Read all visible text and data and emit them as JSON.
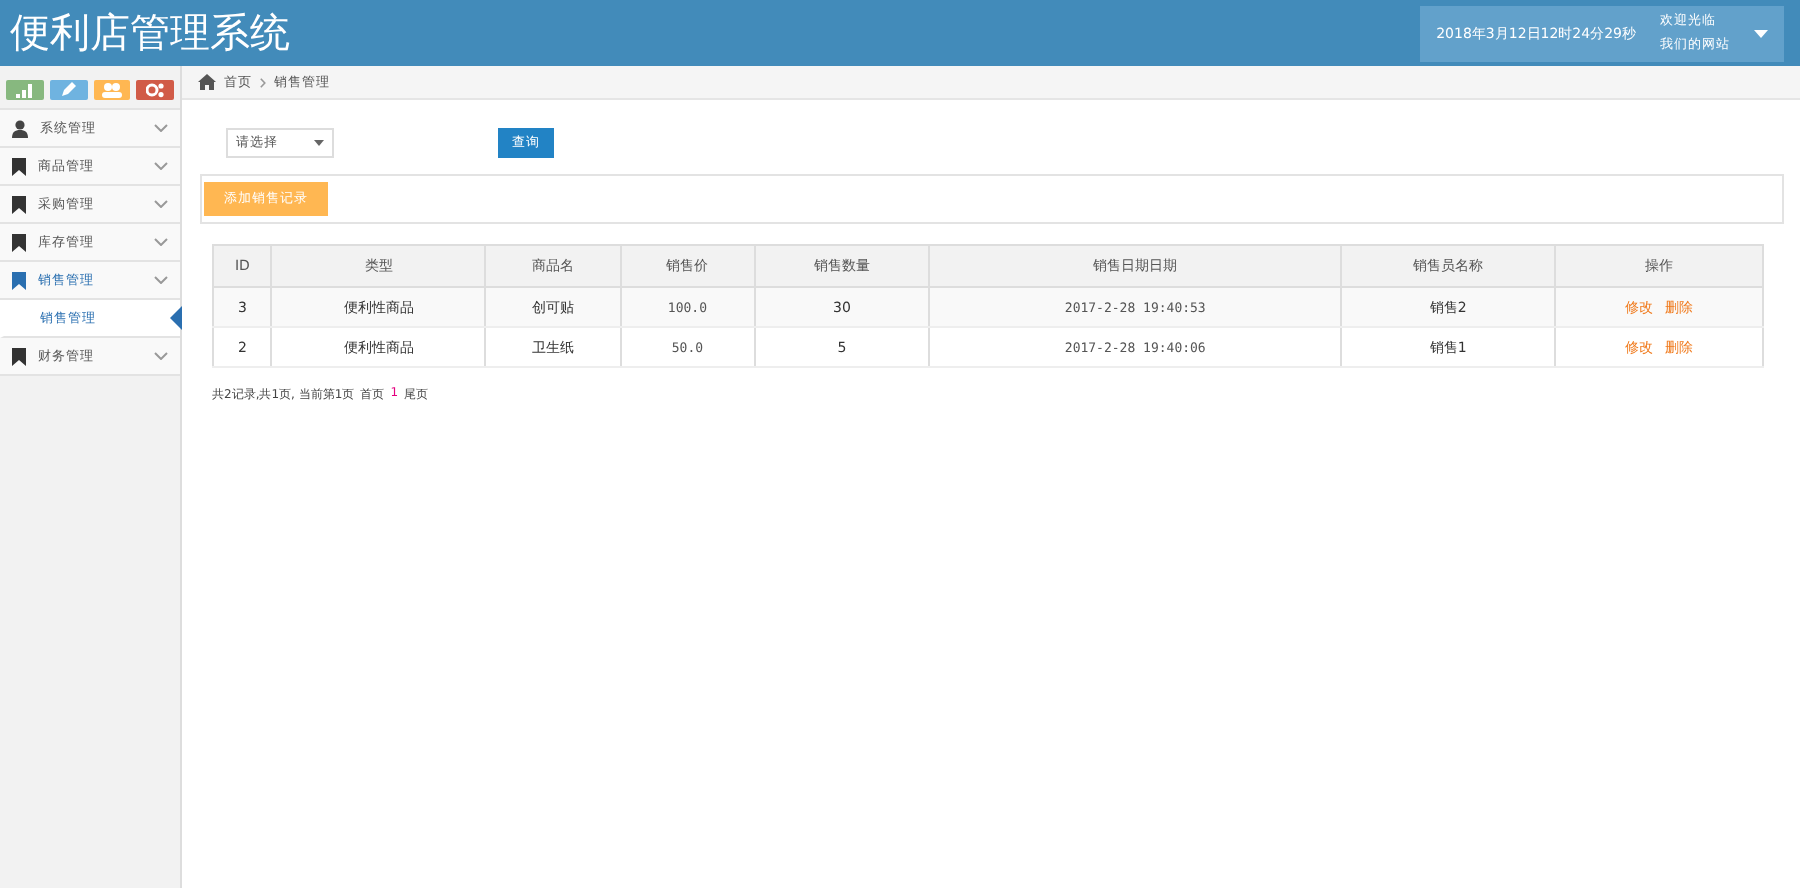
{
  "header": {
    "title": "便利店管理系统",
    "datetime": "2018年3月12日12时24分29秒",
    "greeting": "欢迎光临",
    "site": "我们的网站"
  },
  "sidebar": {
    "items": [
      {
        "label": "系统管理",
        "expanded": false
      },
      {
        "label": "商品管理",
        "expanded": false
      },
      {
        "label": "采购管理",
        "expanded": false
      },
      {
        "label": "库存管理",
        "expanded": false
      },
      {
        "label": "销售管理",
        "expanded": true,
        "children": [
          {
            "label": "销售管理",
            "selected": true
          }
        ]
      },
      {
        "label": "财务管理",
        "expanded": false
      }
    ]
  },
  "breadcrumb": [
    "首页",
    "销售管理"
  ],
  "filter": {
    "select": "请选择",
    "button": "查询"
  },
  "add_button": "添加销售记录",
  "table": {
    "columns": [
      "ID",
      "类型",
      "商品名",
      "销售价",
      "销售数量",
      "销售日期日期",
      "销售员名称",
      "操作"
    ],
    "rows": [
      {
        "cells": [
          "3",
          "便利性商品",
          "创可贴",
          "100.0",
          "30",
          "2017-2-28 19:40:53",
          "销售2"
        ],
        "actions": [
          "修改",
          "删除"
        ]
      },
      {
        "cells": [
          "2",
          "便利性商品",
          "卫生纸",
          "50.0",
          "5",
          "2017-2-28 19:40:06",
          "销售1"
        ],
        "actions": [
          "修改",
          "删除"
        ]
      }
    ]
  },
  "pagination": {
    "summary": "共2记录,共1页, 当前第1页",
    "first": "首页",
    "current": "1",
    "last": "尾页"
  }
}
